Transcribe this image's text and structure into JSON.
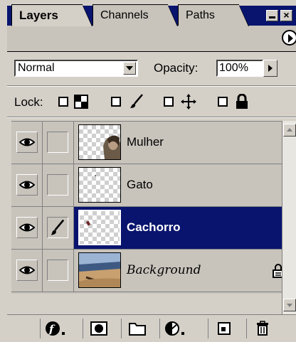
{
  "tabs": [
    {
      "label": "Layers",
      "active": true
    },
    {
      "label": "Channels",
      "active": false
    },
    {
      "label": "Paths",
      "active": false
    }
  ],
  "blend_mode": {
    "selected": "Normal"
  },
  "opacity": {
    "label": "Opacity:",
    "value": "100%"
  },
  "lock": {
    "label": "Lock:",
    "options": [
      {
        "icon": "transparency-icon"
      },
      {
        "icon": "brush-icon"
      },
      {
        "icon": "move-icon"
      },
      {
        "icon": "lock-icon"
      }
    ]
  },
  "layers": [
    {
      "name": "Mulher",
      "visible": true,
      "selected": false,
      "linked_icon": ""
    },
    {
      "name": "Gato",
      "visible": true,
      "selected": false,
      "linked_icon": ""
    },
    {
      "name": "Cachorro",
      "visible": true,
      "selected": true,
      "linked_icon": "brush-icon"
    },
    {
      "name": "Background",
      "visible": true,
      "selected": false,
      "locked": true,
      "linked_icon": ""
    }
  ],
  "bottom_buttons": [
    {
      "icon": "layer-style-icon"
    },
    {
      "icon": "layer-mask-icon"
    },
    {
      "icon": "new-set-icon"
    },
    {
      "icon": "adjustment-layer-icon"
    },
    {
      "icon": "new-layer-icon"
    },
    {
      "icon": "trash-icon"
    }
  ],
  "colors": {
    "selected": "#08146e",
    "titlebar": "#08146e",
    "panel": "#d4d0c8"
  }
}
